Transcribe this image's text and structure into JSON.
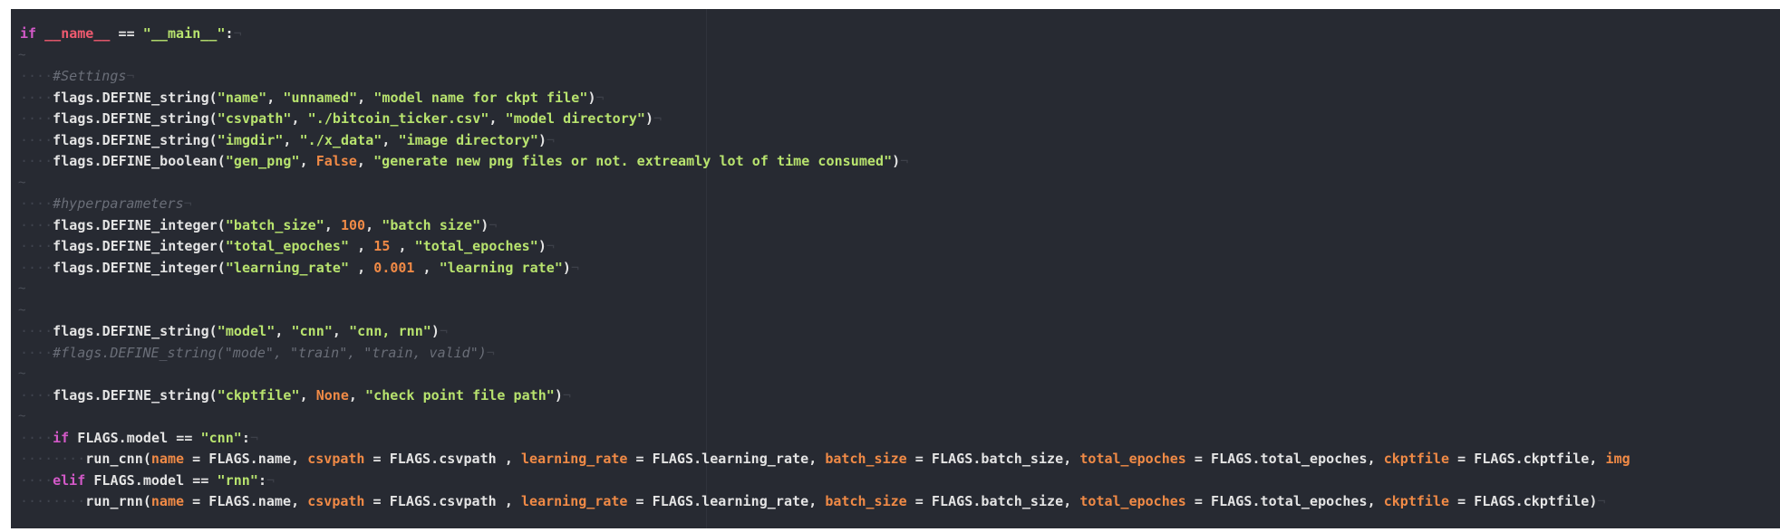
{
  "editor": {
    "tilde": "~",
    "eol": "¬",
    "lines": [
      {
        "indent": "",
        "tokens": [
          [
            "kw",
            "if"
          ],
          [
            "pl",
            " "
          ],
          [
            "dunder",
            "__name__"
          ],
          [
            "pl",
            " == "
          ],
          [
            "str",
            "\"__main__\""
          ],
          [
            "pl",
            ":"
          ]
        ]
      },
      {
        "blank": true
      },
      {
        "indent": "····",
        "tokens": [
          [
            "cmt",
            "#Settings"
          ]
        ]
      },
      {
        "indent": "····",
        "tokens": [
          [
            "pl",
            "flags.DEFINE_string("
          ],
          [
            "str",
            "\"name\""
          ],
          [
            "pl",
            ", "
          ],
          [
            "str",
            "\"unnamed\""
          ],
          [
            "pl",
            ", "
          ],
          [
            "str",
            "\"model name for ckpt file\""
          ],
          [
            "pl",
            ")"
          ]
        ]
      },
      {
        "indent": "····",
        "tokens": [
          [
            "pl",
            "flags.DEFINE_string("
          ],
          [
            "str",
            "\"csvpath\""
          ],
          [
            "pl",
            ", "
          ],
          [
            "str",
            "\"./bitcoin_ticker.csv\""
          ],
          [
            "pl",
            ", "
          ],
          [
            "str",
            "\"model directory\""
          ],
          [
            "pl",
            ")"
          ]
        ]
      },
      {
        "indent": "····",
        "tokens": [
          [
            "pl",
            "flags.DEFINE_string("
          ],
          [
            "str",
            "\"imgdir\""
          ],
          [
            "pl",
            ", "
          ],
          [
            "str",
            "\"./x_data\""
          ],
          [
            "pl",
            ", "
          ],
          [
            "str",
            "\"image directory\""
          ],
          [
            "pl",
            ")"
          ]
        ]
      },
      {
        "indent": "····",
        "tokens": [
          [
            "pl",
            "flags.DEFINE_boolean("
          ],
          [
            "str",
            "\"gen_png\""
          ],
          [
            "pl",
            ", "
          ],
          [
            "const",
            "False"
          ],
          [
            "pl",
            ", "
          ],
          [
            "str",
            "\"generate new png files or not. extreamly lot of time consumed\""
          ],
          [
            "pl",
            ")"
          ]
        ]
      },
      {
        "blank": true
      },
      {
        "indent": "····",
        "tokens": [
          [
            "cmt",
            "#hyperparameters"
          ]
        ]
      },
      {
        "indent": "····",
        "tokens": [
          [
            "pl",
            "flags.DEFINE_integer("
          ],
          [
            "str",
            "\"batch_size\""
          ],
          [
            "pl",
            ", "
          ],
          [
            "num",
            "100"
          ],
          [
            "pl",
            ", "
          ],
          [
            "str",
            "\"batch size\""
          ],
          [
            "pl",
            ")"
          ]
        ]
      },
      {
        "indent": "····",
        "tokens": [
          [
            "pl",
            "flags.DEFINE_integer("
          ],
          [
            "str",
            "\"total_epoches\""
          ],
          [
            "pl",
            " , "
          ],
          [
            "num",
            "15"
          ],
          [
            "pl",
            " , "
          ],
          [
            "str",
            "\"total_epoches\""
          ],
          [
            "pl",
            ")"
          ]
        ]
      },
      {
        "indent": "····",
        "tokens": [
          [
            "pl",
            "flags.DEFINE_integer("
          ],
          [
            "str",
            "\"learning_rate\""
          ],
          [
            "pl",
            " , "
          ],
          [
            "num",
            "0.001"
          ],
          [
            "pl",
            " , "
          ],
          [
            "str",
            "\"learning rate\""
          ],
          [
            "pl",
            ")"
          ]
        ]
      },
      {
        "blank": true
      },
      {
        "blank": true
      },
      {
        "indent": "····",
        "tokens": [
          [
            "pl",
            "flags.DEFINE_string("
          ],
          [
            "str",
            "\"model\""
          ],
          [
            "pl",
            ", "
          ],
          [
            "str",
            "\"cnn\""
          ],
          [
            "pl",
            ", "
          ],
          [
            "str",
            "\"cnn, rnn\""
          ],
          [
            "pl",
            ")"
          ]
        ]
      },
      {
        "indent": "····",
        "tokens": [
          [
            "cmt",
            "#flags.DEFINE_string(\"mode\", \"train\", \"train, valid\")"
          ]
        ]
      },
      {
        "blank": true
      },
      {
        "indent": "····",
        "tokens": [
          [
            "pl",
            "flags.DEFINE_string("
          ],
          [
            "str",
            "\"ckptfile\""
          ],
          [
            "pl",
            ", "
          ],
          [
            "const",
            "None"
          ],
          [
            "pl",
            ", "
          ],
          [
            "str",
            "\"check point file path\""
          ],
          [
            "pl",
            ")"
          ]
        ]
      },
      {
        "blank": true
      },
      {
        "indent": "····",
        "tokens": [
          [
            "kw",
            "if"
          ],
          [
            "pl",
            " FLAGS.model == "
          ],
          [
            "str",
            "\"cnn\""
          ],
          [
            "pl",
            ":"
          ]
        ]
      },
      {
        "indent": "········",
        "tokens": [
          [
            "pl",
            "run_cnn("
          ],
          [
            "param",
            "name"
          ],
          [
            "pl",
            " = FLAGS.name, "
          ],
          [
            "param",
            "csvpath"
          ],
          [
            "pl",
            " = FLAGS.csvpath , "
          ],
          [
            "param",
            "learning_rate"
          ],
          [
            "pl",
            " = FLAGS.learning_rate, "
          ],
          [
            "param",
            "batch_size"
          ],
          [
            "pl",
            " = FLAGS.batch_size, "
          ],
          [
            "param",
            "total_epoches"
          ],
          [
            "pl",
            " = FLAGS.total_epoches, "
          ],
          [
            "param",
            "ckptfile"
          ],
          [
            "pl",
            " = FLAGS.ckptfile, "
          ],
          [
            "param",
            "img"
          ]
        ],
        "noeol": true
      },
      {
        "indent": "····",
        "tokens": [
          [
            "kw",
            "elif"
          ],
          [
            "pl",
            " FLAGS.model == "
          ],
          [
            "str",
            "\"rnn\""
          ],
          [
            "pl",
            ":"
          ]
        ]
      },
      {
        "indent": "········",
        "tokens": [
          [
            "pl",
            "run_rnn("
          ],
          [
            "param",
            "name"
          ],
          [
            "pl",
            " = FLAGS.name, "
          ],
          [
            "param",
            "csvpath"
          ],
          [
            "pl",
            " = FLAGS.csvpath , "
          ],
          [
            "param",
            "learning_rate"
          ],
          [
            "pl",
            " = FLAGS.learning_rate, "
          ],
          [
            "param",
            "batch_size"
          ],
          [
            "pl",
            " = FLAGS.batch_size, "
          ],
          [
            "param",
            "total_epoches"
          ],
          [
            "pl",
            " = FLAGS.total_epoches, "
          ],
          [
            "param",
            "ckptfile"
          ],
          [
            "pl",
            " = FLAGS.ckptfile)"
          ]
        ]
      }
    ]
  }
}
